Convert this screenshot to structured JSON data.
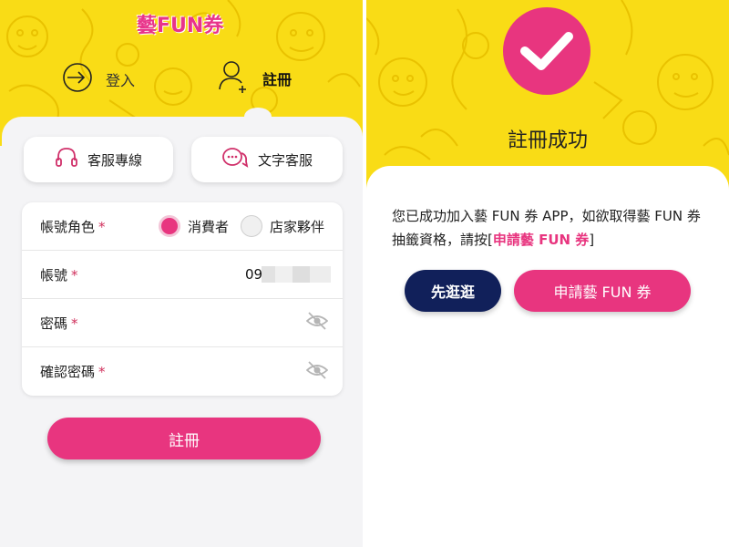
{
  "brand": {
    "logo_text": "藝FUN券",
    "accent": "#e8357f",
    "yellow": "#f9dc16",
    "navy": "#11205a"
  },
  "left": {
    "tabs": [
      {
        "label": "登入",
        "icon": "login-arrow-icon",
        "active": false
      },
      {
        "label": "註冊",
        "icon": "add-user-icon",
        "active": true
      }
    ],
    "service_buttons": [
      {
        "label": "客服專線",
        "icon": "headset-icon"
      },
      {
        "label": "文字客服",
        "icon": "chat-bubbles-icon"
      }
    ],
    "form": {
      "role": {
        "label": "帳號角色",
        "required": "*",
        "options": [
          "消費者",
          "店家夥伴"
        ],
        "selected": "消費者"
      },
      "account": {
        "label": "帳號",
        "required": "*",
        "value": "09"
      },
      "password": {
        "label": "密碼",
        "required": "*",
        "value": ""
      },
      "confirm_password": {
        "label": "確認密碼",
        "required": "*",
        "value": ""
      }
    },
    "submit_label": "註冊"
  },
  "right": {
    "title": "註冊成功",
    "message_prefix": "您已成功加入藝 FUN 券 APP，如欲取得藝 FUN 券抽籤資格，請按[",
    "message_link": "申請藝 FUN 券",
    "message_suffix": "]",
    "buttons": {
      "browse": "先逛逛",
      "apply": "申請藝 FUN 券"
    }
  }
}
